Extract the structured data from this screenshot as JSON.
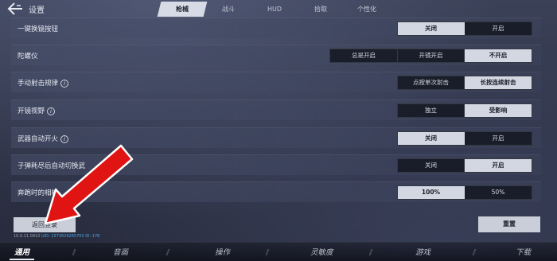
{
  "header": {
    "title": "设置",
    "tabs": [
      {
        "label": "枪械",
        "active": true
      },
      {
        "label": "战斗",
        "active": false
      },
      {
        "label": "HUD",
        "active": false
      },
      {
        "label": "拾取",
        "active": false
      },
      {
        "label": "个性化",
        "active": false
      }
    ]
  },
  "settings": [
    {
      "label": "一键换镜按钮",
      "info": false,
      "options": [
        "关闭",
        "开启"
      ],
      "selected": 0
    },
    {
      "label": "陀螺仪",
      "info": false,
      "options": [
        "总是开启",
        "开镜开启",
        "不开启"
      ],
      "selected": 2
    },
    {
      "label": "手动射击规律",
      "info": true,
      "options": [
        "点按单次射击",
        "长按连续射击"
      ],
      "selected": 1
    },
    {
      "label": "开镜视野",
      "info": true,
      "options": [
        "独立",
        "受影响"
      ],
      "selected": 1
    },
    {
      "label": "武器自动开火",
      "info": true,
      "options": [
        "关闭",
        "开启"
      ],
      "selected": 0
    },
    {
      "label": "子弹耗尽后自动切换武",
      "info": false,
      "options": [
        "关闭",
        "开启"
      ],
      "selected": 1
    },
    {
      "label": "奔跑时的相机",
      "info": false,
      "options": [
        "100%",
        "50%"
      ],
      "selected": 0
    }
  ],
  "info_glyph": "i",
  "buttons": {
    "back_login": "返回登录",
    "reset": "重置"
  },
  "version": {
    "text": "10.0.11.0810",
    "uid": "UID: 1573629265703 ID: 178"
  },
  "bottom_nav": [
    {
      "label": "通用",
      "active": true
    },
    {
      "label": "音画",
      "active": false
    },
    {
      "label": "操作",
      "active": false
    },
    {
      "label": "灵敏度",
      "active": false
    },
    {
      "label": "游戏",
      "active": false
    },
    {
      "label": "下载",
      "active": false
    }
  ],
  "colors": {
    "arrow": "#e11414",
    "selected_option": "#d2d7e2",
    "accent_link": "#4ea6e8"
  }
}
